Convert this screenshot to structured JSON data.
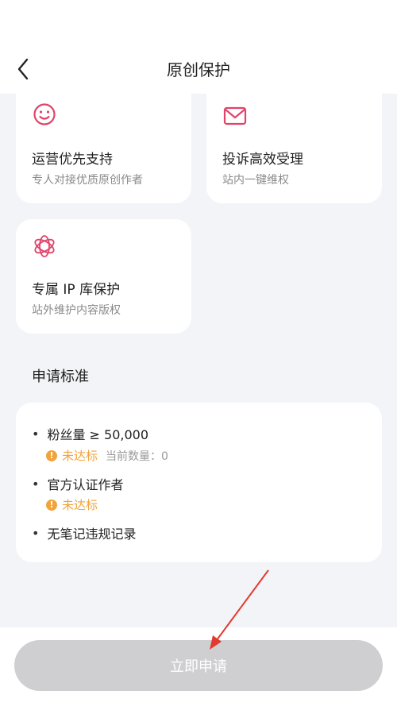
{
  "header": {
    "title": "原创保护"
  },
  "benefits": [
    {
      "title": "运营优先支持",
      "subtitle": "专人对接优质原创作者",
      "icon": "smile-icon"
    },
    {
      "title": "投诉高效受理",
      "subtitle": "站内一键维权",
      "icon": "mail-icon"
    },
    {
      "title": "专属 IP 库保护",
      "subtitle": "站外维护内容版权",
      "icon": "flower-icon"
    }
  ],
  "criteria": {
    "section_title": "申请标准",
    "items": [
      {
        "label": "粉丝量 ≥ 50,000",
        "status": "未达标",
        "extra": "当前数量：0"
      },
      {
        "label": "官方认证作者",
        "status": "未达标"
      },
      {
        "label": "无笔记违规记录"
      }
    ]
  },
  "footer": {
    "apply_label": "立即申请"
  },
  "colors": {
    "accent": "#e0446a",
    "warning": "#f2a33a",
    "button_disabled": "#cfcfd1",
    "annotation_arrow": "#e23a2e"
  }
}
